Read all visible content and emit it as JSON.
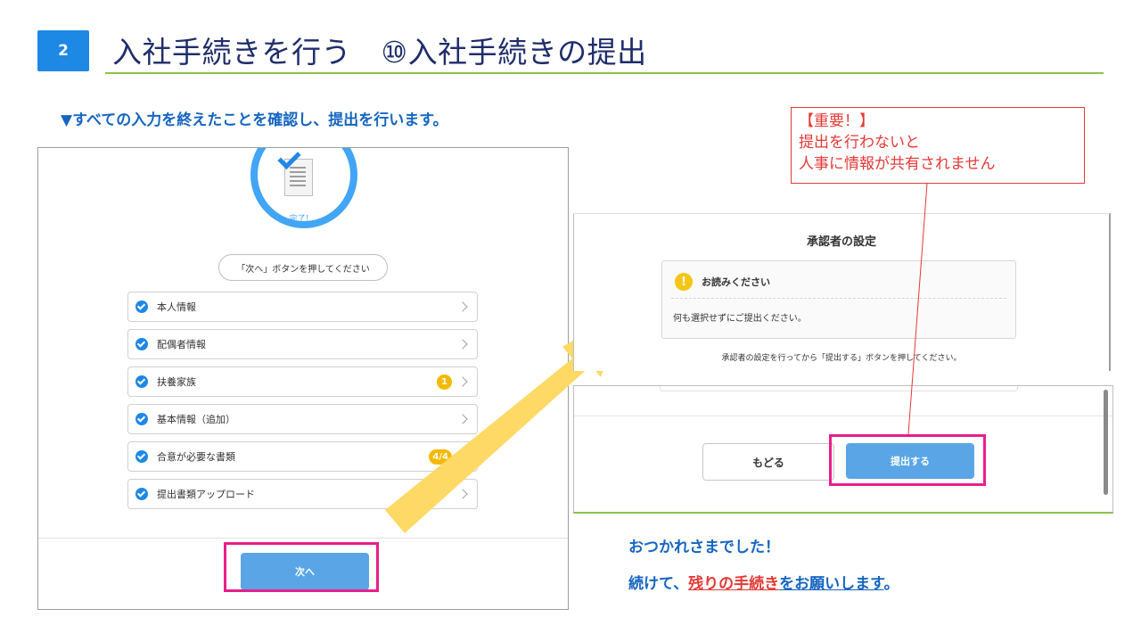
{
  "header": {
    "step_number": "2",
    "title": "入社手続きを行う　⑩入社手続きの提出"
  },
  "instruction": "▼すべての入力を終えたことを確認し、提出を行います。",
  "left_screen": {
    "done_label": "完了！",
    "press_next_label": "「次へ」ボタンを押してください",
    "steps": [
      {
        "label": "本人情報",
        "badge": ""
      },
      {
        "label": "配偶者情報",
        "badge": ""
      },
      {
        "label": "扶養家族",
        "badge": "1"
      },
      {
        "label": "基本情報（追加）",
        "badge": ""
      },
      {
        "label": "合意が必要な書類",
        "badge": "4/4"
      },
      {
        "label": "提出書類アップロード",
        "badge": ""
      }
    ],
    "next_button": "次へ"
  },
  "note": {
    "lines": [
      "【重要！】",
      "提出を行わないと",
      "人事に情報が共有されません"
    ]
  },
  "approver_screen": {
    "title": "承認者の設定",
    "read_heading": "お読みください",
    "read_body": "何も選択せずにご提出ください。",
    "footer_note": "承認者の設定を行ってから「提出する」ボタンを押してください。"
  },
  "submit_screen": {
    "back_button": "もどる",
    "submit_button": "提出する"
  },
  "closing": {
    "line1": "おつかれさまでした！",
    "line2_prefix": "続けて、",
    "line2_highlight": "残りの手続き",
    "line2_suffix": "をお願いします",
    "line2_end": "。"
  },
  "colors": {
    "accent_blue": "#1e88e5",
    "button_blue": "#5aa5e6",
    "highlight_pink": "#e91e8c",
    "warning_red": "#e53935",
    "arrow_yellow": "#ffd966",
    "title_rule_green": "#8bc34a"
  }
}
